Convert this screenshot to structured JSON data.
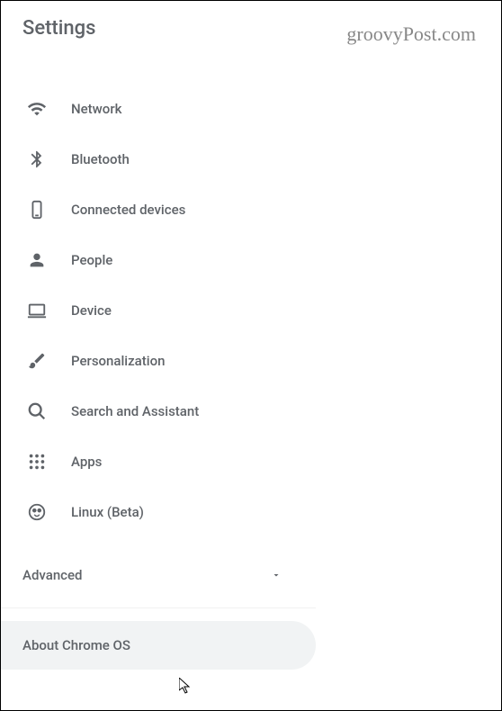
{
  "header": {
    "title": "Settings",
    "watermark": "groovyPost.com"
  },
  "menu": {
    "items": [
      {
        "icon": "wifi-icon",
        "label": "Network"
      },
      {
        "icon": "bluetooth-icon",
        "label": "Bluetooth"
      },
      {
        "icon": "phone-icon",
        "label": "Connected devices"
      },
      {
        "icon": "person-icon",
        "label": "People"
      },
      {
        "icon": "laptop-icon",
        "label": "Device"
      },
      {
        "icon": "brush-icon",
        "label": "Personalization"
      },
      {
        "icon": "search-icon",
        "label": "Search and Assistant"
      },
      {
        "icon": "apps-icon",
        "label": "Apps"
      },
      {
        "icon": "linux-icon",
        "label": "Linux (Beta)"
      }
    ]
  },
  "advanced": {
    "label": "Advanced"
  },
  "about": {
    "label": "About Chrome OS"
  }
}
